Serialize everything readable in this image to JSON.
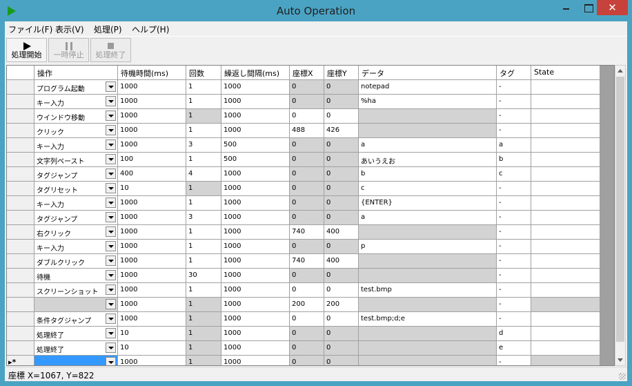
{
  "window": {
    "title": "Auto Operation"
  },
  "menu": {
    "items": [
      "ファイル(F)",
      "表示(V)",
      "処理(P)",
      "ヘルプ(H)"
    ]
  },
  "toolbar": {
    "start": "処理開始",
    "pause": "一時停止",
    "end": "処理終了"
  },
  "grid": {
    "headers": [
      "操作",
      "待機時間(ms)",
      "回数",
      "繰返し間隔(ms)",
      "座標X",
      "座標Y",
      "データ",
      "タグ",
      "State"
    ],
    "rows": [
      {
        "op": "プログラム起動",
        "wait": "1000",
        "count": "1",
        "interval": "1000",
        "x": "0",
        "y": "0",
        "data": "notepad",
        "tag": "-",
        "state": ""
      },
      {
        "op": "キー入力",
        "wait": "1000",
        "count": "1",
        "interval": "1000",
        "x": "0",
        "y": "0",
        "data": "%ha",
        "tag": "-",
        "state": ""
      },
      {
        "op": "ウインドウ移動",
        "wait": "1000",
        "count": "1",
        "interval": "1000",
        "x": "0",
        "y": "0",
        "data": "",
        "tag": "-",
        "state": ""
      },
      {
        "op": "クリック",
        "wait": "1000",
        "count": "1",
        "interval": "1000",
        "x": "488",
        "y": "426",
        "data": "",
        "tag": "-",
        "state": ""
      },
      {
        "op": "キー入力",
        "wait": "1000",
        "count": "3",
        "interval": "500",
        "x": "0",
        "y": "0",
        "data": "a",
        "tag": "a",
        "state": ""
      },
      {
        "op": "文字列ペースト",
        "wait": "100",
        "count": "1",
        "interval": "500",
        "x": "0",
        "y": "0",
        "data": "あいうえお",
        "tag": "b",
        "state": ""
      },
      {
        "op": "タグジャンプ",
        "wait": "400",
        "count": "4",
        "interval": "1000",
        "x": "0",
        "y": "0",
        "data": "b",
        "tag": "c",
        "state": ""
      },
      {
        "op": "タグリセット",
        "wait": "10",
        "count": "1",
        "interval": "1000",
        "x": "0",
        "y": "0",
        "data": "c",
        "tag": "-",
        "state": ""
      },
      {
        "op": "キー入力",
        "wait": "1000",
        "count": "1",
        "interval": "1000",
        "x": "0",
        "y": "0",
        "data": "{ENTER}",
        "tag": "-",
        "state": ""
      },
      {
        "op": "タグジャンプ",
        "wait": "1000",
        "count": "3",
        "interval": "1000",
        "x": "0",
        "y": "0",
        "data": "a",
        "tag": "-",
        "state": ""
      },
      {
        "op": "右クリック",
        "wait": "1000",
        "count": "1",
        "interval": "1000",
        "x": "740",
        "y": "400",
        "data": "",
        "tag": "-",
        "state": ""
      },
      {
        "op": "キー入力",
        "wait": "1000",
        "count": "1",
        "interval": "1000",
        "x": "0",
        "y": "0",
        "data": "p",
        "tag": "-",
        "state": ""
      },
      {
        "op": "ダブルクリック",
        "wait": "1000",
        "count": "1",
        "interval": "1000",
        "x": "740",
        "y": "400",
        "data": "",
        "tag": "-",
        "state": ""
      },
      {
        "op": "待機",
        "wait": "1000",
        "count": "30",
        "interval": "1000",
        "x": "0",
        "y": "0",
        "data": "",
        "tag": "-",
        "state": ""
      },
      {
        "op": "スクリーンショット",
        "wait": "1000",
        "count": "1",
        "interval": "1000",
        "x": "0",
        "y": "0",
        "data": "test.bmp",
        "tag": "-",
        "state": ""
      },
      {
        "op": "",
        "wait": "1000",
        "count": "1",
        "interval": "1000",
        "x": "200",
        "y": "200",
        "data": "",
        "tag": "-",
        "state": ""
      },
      {
        "op": "条件タグジャンプ",
        "wait": "1000",
        "count": "1",
        "interval": "1000",
        "x": "0",
        "y": "0",
        "data": "test.bmp;d;e",
        "tag": "-",
        "state": ""
      },
      {
        "op": "処理終了",
        "wait": "10",
        "count": "1",
        "interval": "1000",
        "x": "0",
        "y": "0",
        "data": "",
        "tag": "d",
        "state": ""
      },
      {
        "op": "処理終了",
        "wait": "10",
        "count": "1",
        "interval": "1000",
        "x": "0",
        "y": "0",
        "data": "",
        "tag": "e",
        "state": ""
      },
      {
        "op": "",
        "wait": "1000",
        "count": "1",
        "interval": "1000",
        "x": "0",
        "y": "0",
        "data": "",
        "tag": "-",
        "state": "",
        "new_row_marker": "▸*"
      }
    ]
  },
  "status": {
    "text": "座標 X=1067, Y=822"
  }
}
